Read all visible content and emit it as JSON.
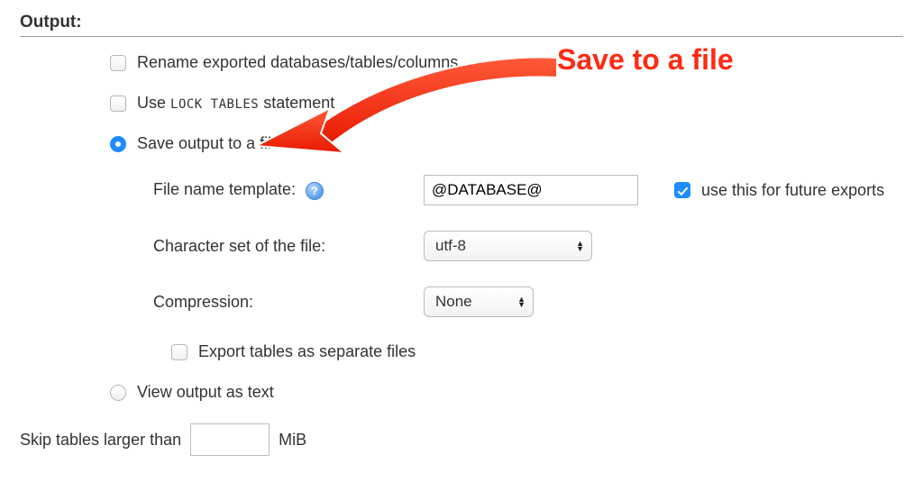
{
  "section_title": "Output:",
  "options": {
    "rename": {
      "label": "Rename exported databases/tables/columns",
      "checked": false
    },
    "lock_tables": {
      "label_before": "Use ",
      "code": "LOCK TABLES",
      "label_after": " statement",
      "checked": false
    },
    "save_to_file": {
      "label": "Save output to a file",
      "selected": true
    },
    "view_as_text": {
      "label": "View output as text",
      "selected": false
    }
  },
  "file": {
    "template_label": "File name template:",
    "template_value": "@DATABASE@",
    "future_label": "use this for future exports",
    "future_checked": true,
    "charset_label": "Character set of the file:",
    "charset_value": "utf-8",
    "compression_label": "Compression:",
    "compression_value": "None",
    "export_separate": {
      "label": "Export tables as separate files",
      "checked": false
    }
  },
  "skip": {
    "label_before": "Skip tables larger than",
    "unit": "MiB",
    "value": ""
  },
  "annotation": "Save to a file"
}
